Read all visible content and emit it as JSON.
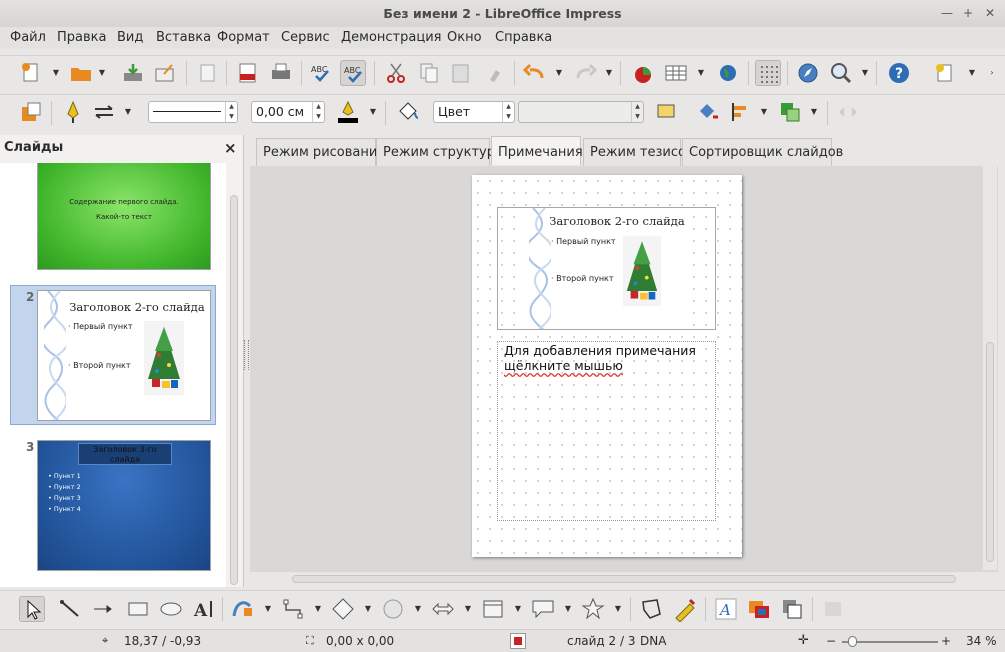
{
  "window": {
    "title": "Без имени 2 - LibreOffice Impress"
  },
  "menu": [
    "Файл",
    "Правка",
    "Вид",
    "Вставка",
    "Формат",
    "Сервис",
    "Демонстрация",
    "Окно",
    "Справка"
  ],
  "line_toolbar": {
    "line_width": "0,00 см",
    "area_style": "Цвет",
    "area_fill": ""
  },
  "slides_panel": {
    "title": "Слайды",
    "close_label": "×",
    "slides": [
      {
        "number": "1",
        "lines": [
          "Содержание первого слайда.",
          "Какой-то текст"
        ]
      },
      {
        "number": "2",
        "title": "Заголовок 2-го слайда",
        "bullets": [
          "Первый пункт",
          "Второй пункт"
        ]
      },
      {
        "number": "3",
        "title": "Заголовок 3-го слайда",
        "bullets": [
          "Пункт 1",
          "Пункт 2",
          "Пункт 3",
          "Пункт 4"
        ]
      }
    ]
  },
  "view_tabs": [
    "Режим рисования",
    "Режим структуры",
    "Примечания",
    "Режим тезисов",
    "Сортировщик слайдов"
  ],
  "active_tab": "Примечания",
  "notes_page": {
    "slide_title": "Заголовок 2-го слайда",
    "bullets": [
      "Первый пункт",
      "Второй пункт"
    ],
    "notes_placeholder_line1": "Для добавления примечания",
    "notes_placeholder_line2": "щёлкните мышью"
  },
  "status": {
    "position": "18,37 / -0,93",
    "size": "0,00 x 0,00",
    "slide": "слайд 2 / 3",
    "layout": "DNA",
    "zoom_level": "34 %"
  },
  "colors": {
    "green_slide": "#4cbf2a",
    "blue_slide": "#2a5ea8",
    "accent": "#2e6db5"
  }
}
